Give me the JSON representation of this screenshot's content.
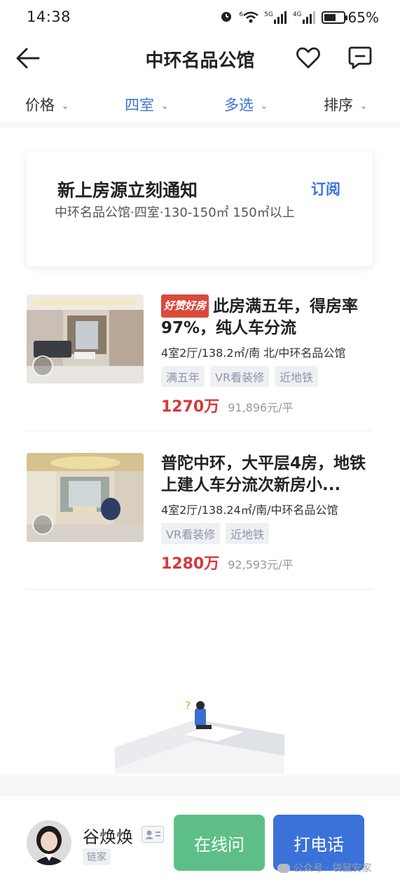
{
  "status_bar": {
    "time": "14:38",
    "network_labels": [
      "6",
      "5G",
      "4G"
    ],
    "battery": "65%",
    "battery_level": 0.65
  },
  "header": {
    "title": "中环名品公馆",
    "icons": [
      "back-arrow-icon",
      "heart-icon",
      "message-icon"
    ]
  },
  "filters": [
    {
      "label": "价格",
      "active": false
    },
    {
      "label": "四室",
      "active": true
    },
    {
      "label": "多选",
      "active": true
    },
    {
      "label": "排序",
      "active": false
    }
  ],
  "subscribe": {
    "title": "新上房源立刻通知",
    "button": "订阅",
    "description": "中环名品公馆·四室·130-150㎡ 150㎡以上"
  },
  "listings": [
    {
      "badge": "好赞好房",
      "title": "此房满五年，得房率97%，纯人车分流",
      "meta": "4室2厅/138.2㎡/南 北/中环名品公馆",
      "tags": [
        "满五年",
        "VR看装修",
        "近地铁"
      ],
      "price": "1270万",
      "unit_price": "91,896元/平"
    },
    {
      "title": "普陀中环，大平层4房，地铁上建人车分流次新房小...",
      "meta": "4室2厅/138.24㎡/南/中环名品公馆",
      "tags": [
        "VR看装修",
        "近地铁"
      ],
      "price": "1280万",
      "unit_price": "92,593元/平"
    }
  ],
  "agent": {
    "name": "谷焕焕",
    "company": "链家",
    "chat_button": "在线问",
    "call_button": "打电话"
  },
  "watermark": "公众号 · 袋鼠安家",
  "colors": {
    "accent": "#3b72d9",
    "price": "#d6393a",
    "chat": "#5dbf87",
    "badge": "#d94a3c"
  }
}
